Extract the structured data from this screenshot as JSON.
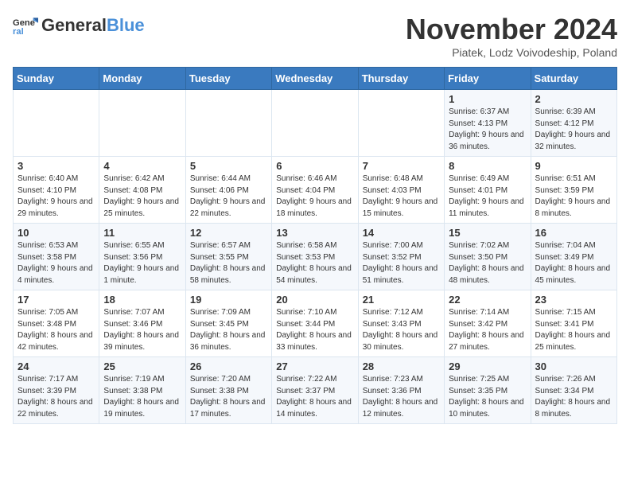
{
  "header": {
    "logo_general": "General",
    "logo_blue": "Blue",
    "month_title": "November 2024",
    "subtitle": "Piatek, Lodz Voivodeship, Poland"
  },
  "days_of_week": [
    "Sunday",
    "Monday",
    "Tuesday",
    "Wednesday",
    "Thursday",
    "Friday",
    "Saturday"
  ],
  "weeks": [
    [
      {
        "day": "",
        "detail": ""
      },
      {
        "day": "",
        "detail": ""
      },
      {
        "day": "",
        "detail": ""
      },
      {
        "day": "",
        "detail": ""
      },
      {
        "day": "",
        "detail": ""
      },
      {
        "day": "1",
        "detail": "Sunrise: 6:37 AM\nSunset: 4:13 PM\nDaylight: 9 hours\nand 36 minutes."
      },
      {
        "day": "2",
        "detail": "Sunrise: 6:39 AM\nSunset: 4:12 PM\nDaylight: 9 hours\nand 32 minutes."
      }
    ],
    [
      {
        "day": "3",
        "detail": "Sunrise: 6:40 AM\nSunset: 4:10 PM\nDaylight: 9 hours\nand 29 minutes."
      },
      {
        "day": "4",
        "detail": "Sunrise: 6:42 AM\nSunset: 4:08 PM\nDaylight: 9 hours\nand 25 minutes."
      },
      {
        "day": "5",
        "detail": "Sunrise: 6:44 AM\nSunset: 4:06 PM\nDaylight: 9 hours\nand 22 minutes."
      },
      {
        "day": "6",
        "detail": "Sunrise: 6:46 AM\nSunset: 4:04 PM\nDaylight: 9 hours\nand 18 minutes."
      },
      {
        "day": "7",
        "detail": "Sunrise: 6:48 AM\nSunset: 4:03 PM\nDaylight: 9 hours\nand 15 minutes."
      },
      {
        "day": "8",
        "detail": "Sunrise: 6:49 AM\nSunset: 4:01 PM\nDaylight: 9 hours\nand 11 minutes."
      },
      {
        "day": "9",
        "detail": "Sunrise: 6:51 AM\nSunset: 3:59 PM\nDaylight: 9 hours\nand 8 minutes."
      }
    ],
    [
      {
        "day": "10",
        "detail": "Sunrise: 6:53 AM\nSunset: 3:58 PM\nDaylight: 9 hours\nand 4 minutes."
      },
      {
        "day": "11",
        "detail": "Sunrise: 6:55 AM\nSunset: 3:56 PM\nDaylight: 9 hours\nand 1 minute."
      },
      {
        "day": "12",
        "detail": "Sunrise: 6:57 AM\nSunset: 3:55 PM\nDaylight: 8 hours\nand 58 minutes."
      },
      {
        "day": "13",
        "detail": "Sunrise: 6:58 AM\nSunset: 3:53 PM\nDaylight: 8 hours\nand 54 minutes."
      },
      {
        "day": "14",
        "detail": "Sunrise: 7:00 AM\nSunset: 3:52 PM\nDaylight: 8 hours\nand 51 minutes."
      },
      {
        "day": "15",
        "detail": "Sunrise: 7:02 AM\nSunset: 3:50 PM\nDaylight: 8 hours\nand 48 minutes."
      },
      {
        "day": "16",
        "detail": "Sunrise: 7:04 AM\nSunset: 3:49 PM\nDaylight: 8 hours\nand 45 minutes."
      }
    ],
    [
      {
        "day": "17",
        "detail": "Sunrise: 7:05 AM\nSunset: 3:48 PM\nDaylight: 8 hours\nand 42 minutes."
      },
      {
        "day": "18",
        "detail": "Sunrise: 7:07 AM\nSunset: 3:46 PM\nDaylight: 8 hours\nand 39 minutes."
      },
      {
        "day": "19",
        "detail": "Sunrise: 7:09 AM\nSunset: 3:45 PM\nDaylight: 8 hours\nand 36 minutes."
      },
      {
        "day": "20",
        "detail": "Sunrise: 7:10 AM\nSunset: 3:44 PM\nDaylight: 8 hours\nand 33 minutes."
      },
      {
        "day": "21",
        "detail": "Sunrise: 7:12 AM\nSunset: 3:43 PM\nDaylight: 8 hours\nand 30 minutes."
      },
      {
        "day": "22",
        "detail": "Sunrise: 7:14 AM\nSunset: 3:42 PM\nDaylight: 8 hours\nand 27 minutes."
      },
      {
        "day": "23",
        "detail": "Sunrise: 7:15 AM\nSunset: 3:41 PM\nDaylight: 8 hours\nand 25 minutes."
      }
    ],
    [
      {
        "day": "24",
        "detail": "Sunrise: 7:17 AM\nSunset: 3:39 PM\nDaylight: 8 hours\nand 22 minutes."
      },
      {
        "day": "25",
        "detail": "Sunrise: 7:19 AM\nSunset: 3:38 PM\nDaylight: 8 hours\nand 19 minutes."
      },
      {
        "day": "26",
        "detail": "Sunrise: 7:20 AM\nSunset: 3:38 PM\nDaylight: 8 hours\nand 17 minutes."
      },
      {
        "day": "27",
        "detail": "Sunrise: 7:22 AM\nSunset: 3:37 PM\nDaylight: 8 hours\nand 14 minutes."
      },
      {
        "day": "28",
        "detail": "Sunrise: 7:23 AM\nSunset: 3:36 PM\nDaylight: 8 hours\nand 12 minutes."
      },
      {
        "day": "29",
        "detail": "Sunrise: 7:25 AM\nSunset: 3:35 PM\nDaylight: 8 hours\nand 10 minutes."
      },
      {
        "day": "30",
        "detail": "Sunrise: 7:26 AM\nSunset: 3:34 PM\nDaylight: 8 hours\nand 8 minutes."
      }
    ]
  ]
}
